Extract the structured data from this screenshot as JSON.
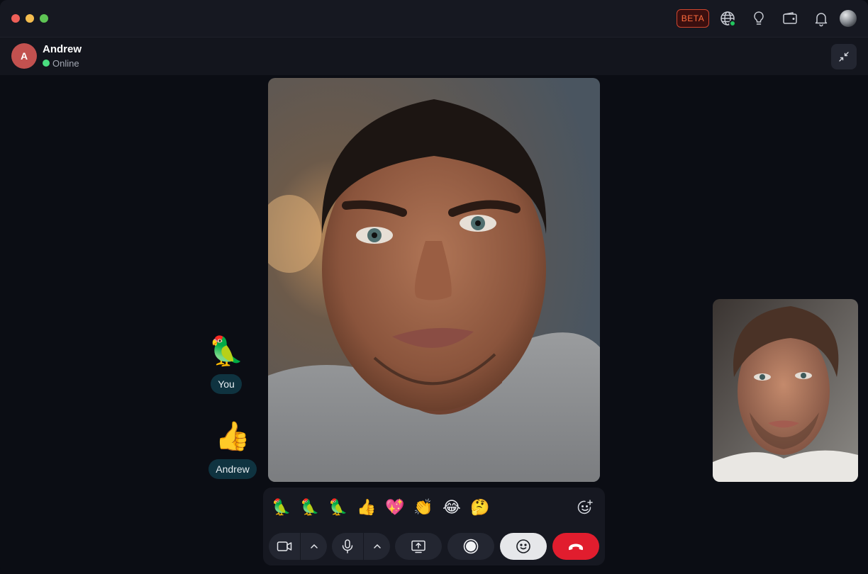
{
  "titlebar": {
    "beta_label": "BETA",
    "icons": [
      "globe-icon",
      "lightbulb-icon",
      "wallet-icon",
      "bell-icon"
    ],
    "globe_status_color": "#22c55e"
  },
  "contact": {
    "initial": "A",
    "name": "Andrew",
    "status": "Online",
    "avatar_color": "#c2514f",
    "status_color": "#4ade80"
  },
  "reactions": [
    {
      "who": "You",
      "emoji": "🦜"
    },
    {
      "who": "Andrew",
      "emoji": "👍"
    }
  ],
  "emoji_bar": [
    "🦜",
    "🦜",
    "🦜",
    "👍",
    "💖",
    "👏",
    "😂",
    "🤔"
  ],
  "controls": {
    "camera": "video-camera-icon",
    "microphone": "microphone-icon",
    "share": "screen-share-icon",
    "record": "record-icon",
    "reactions": "smiley-icon",
    "end_call": "hang-up-icon",
    "end_call_color": "#e11d2e"
  }
}
